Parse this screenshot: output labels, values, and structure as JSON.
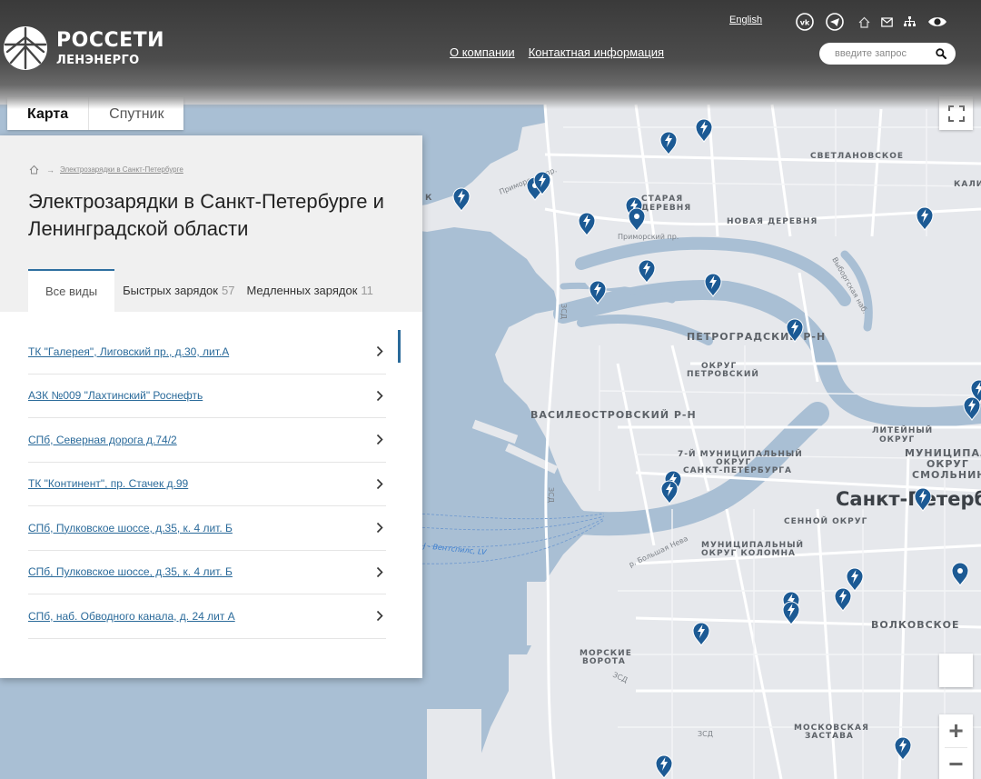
{
  "header": {
    "logo_title": "РОССЕТИ",
    "logo_subtitle": "ЛЕНЭНЕРГО",
    "nav": [
      {
        "label": "О компании"
      },
      {
        "label": "Контактная информация"
      }
    ],
    "lang_link": "English",
    "icons": [
      "vk-icon",
      "telegram-icon",
      "home-icon",
      "mail-icon",
      "sitemap-icon",
      "eye-icon"
    ],
    "search_placeholder": "введите запрос"
  },
  "map": {
    "type_controls": [
      {
        "label": "Карта",
        "active": true
      },
      {
        "label": "Спутник",
        "active": false
      }
    ],
    "labels": {
      "city": "Санкт-Петербург",
      "districts": [
        "СВЕТЛАНОВСКОЕ",
        "КАЛИ",
        "СТАРАЯ",
        "ДЕРЕВНЯ",
        "НОВАЯ ДЕРЕВНЯ",
        "ПЕТРОГРАДСКИЙ Р-Н",
        "ОКРУГ",
        "ПЕТРОВСКИЙ",
        "ВАСИЛЕОСТРОВСКИЙ Р-Н",
        "ЛИТЕЙНЫЙ",
        "ОКРУГ",
        "МУНИЦИПАЛЬ",
        "ОКРУГ",
        "СМОЛЬНИН",
        "7-Й МУНИЦИПАЛЬНЫЙ",
        "ОКРУГ",
        "САНКТ-ПЕТЕРБУРГА",
        "СЕННОЙ ОКРУГ",
        "МУНИЦИПАЛЬНЫЙ",
        "ОКРУГ КОЛОМНА",
        "ВОЛКОВСКОЕ",
        "МОРСКИЕ",
        "ВОРОТА",
        "МОСКОВСКАЯ",
        "ЗАСТАВА"
      ],
      "roads": [
        "Приморский пр.",
        "ЗСД",
        "р. Большая Нева",
        "Выборгская наб."
      ],
      "ferry": "J - Вентспилс, LV",
      "partial": "К"
    },
    "marker_count": 32,
    "marker_color": "#1c5a94"
  },
  "panel": {
    "breadcrumb": "Электрозарядки в Санкт-Петербурге",
    "title": "Электрозарядки в Санкт-Петербурге и Ленинградской области",
    "tabs": [
      {
        "label": "Все виды",
        "count": ""
      },
      {
        "label": "Быстрых зарядок",
        "count": "57"
      },
      {
        "label": "Медленных зарядок",
        "count": "11"
      }
    ],
    "stations": [
      "ТК \"Галерея\", Лиговский пр., д.30, лит.А",
      "АЗК №009 \"Лахтинский\" Роснефть",
      "СПб, Северная дорога д.74/2",
      "ТК \"Континент\", пр. Стачек д.99",
      "СПб, Пулковское шоссе, д.35, к. 4 лит. Б",
      "СПб, Пулковское шоссе, д.35, к. 4 лит. Б",
      "СПб, наб. Обводного канала, д. 24 лит А"
    ]
  },
  "colors": {
    "water": "#a9bfd4",
    "land": "#e6e8ec",
    "link": "#2a6a9a",
    "tab_accent": "#2e6fa0"
  }
}
